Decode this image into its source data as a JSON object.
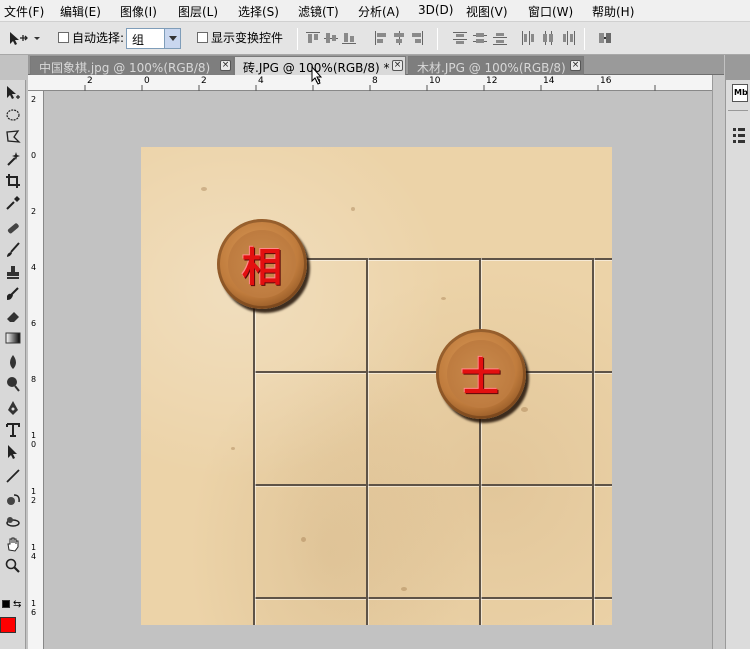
{
  "menu": [
    "文件(F)",
    "编辑(E)",
    "图像(I)",
    "图层(L)",
    "选择(S)",
    "滤镜(T)",
    "分析(A)",
    "3D(D)",
    "视图(V)",
    "窗口(W)",
    "帮助(H)"
  ],
  "options": {
    "auto_select_label": "自动选择:",
    "auto_select_value": "组",
    "show_transform_label": "显示变换控件",
    "move_tool_icon": "move-tool-icon"
  },
  "tabs": [
    {
      "label": "中国象棋.jpg @ 100%(RGB/8)",
      "active": false
    },
    {
      "label": "砖.JPG @ 100%(RGB/8) *",
      "active": true
    },
    {
      "label": "木材.JPG @ 100%(RGB/8)",
      "active": false
    }
  ],
  "ruler_h": [
    "2",
    "0",
    "2",
    "4",
    "6",
    "8",
    "10",
    "12",
    "14",
    "16"
  ],
  "ruler_v": [
    "2",
    "0",
    "2",
    "4",
    "6",
    "8",
    "10",
    "12",
    "14",
    "16"
  ],
  "pieces": [
    {
      "char": "相"
    },
    {
      "char": "士"
    }
  ],
  "right_panel": {
    "label": "Mb"
  },
  "colors": {
    "foreground": "#ff0000",
    "background": "#ffffff",
    "piece_text": "#e31010",
    "board": "#ecd3a8"
  },
  "tools": [
    "move-tool-icon",
    "marquee-tool-icon",
    "lasso-tool-icon",
    "magic-wand-icon",
    "crop-tool-icon",
    "eyedropper-icon",
    "healing-brush-icon",
    "brush-tool-icon",
    "clone-stamp-icon",
    "history-brush-icon",
    "eraser-icon",
    "gradient-tool-icon",
    "blur-tool-icon",
    "dodge-tool-icon",
    "pen-tool-icon",
    "type-tool-icon",
    "path-select-icon",
    "line-tool-icon",
    "3d-rotate-icon",
    "3d-orbit-icon",
    "hand-tool-icon",
    "zoom-tool-icon"
  ]
}
